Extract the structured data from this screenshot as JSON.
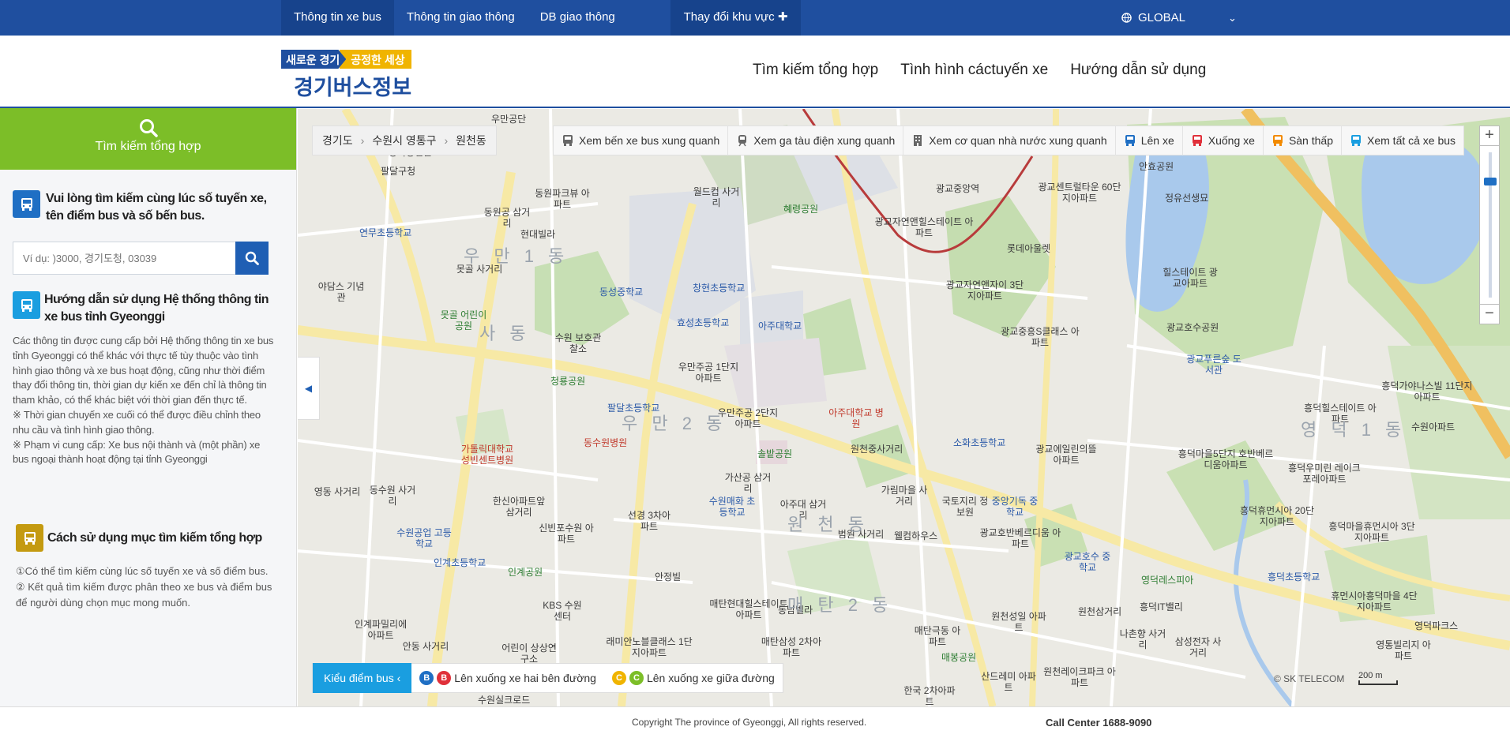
{
  "topbar": {
    "nav": [
      "Thông tin xe bus",
      "Thông tin giao thông",
      "DB giao thông"
    ],
    "region_button": "Thay đổi khu vực ✚",
    "language": "GLOBAL"
  },
  "header": {
    "logo_line1a": "새로운 경기",
    "logo_line1b": "공정한 세상",
    "logo_line2": "경기버스정보",
    "nav": [
      "Tìm kiếm tổng hợp",
      "Tình hình cáctuyến xe",
      "Hướng dẫn sử dụng"
    ]
  },
  "sidebar": {
    "title": "Tìm kiếm tổng hợp",
    "intro": "Vui lòng tìm kiếm cùng lúc số tuyến xe, tên điểm bus và số bến bus.",
    "search_placeholder": "Ví dụ: )3000, 경기도청, 03039",
    "guide_title": "Hướng dẫn sử dụng Hệ thống thông tin xe bus tỉnh Gyeonggi",
    "guide_text": [
      "Các thông tin được cung cấp bởi Hệ thống thông tin xe bus tỉnh Gyeonggi có thể khác với thực tế tùy thuộc vào tình hình giao thông và xe bus hoạt động, cũng như thời điểm thay đổi thông tin, thời gian dự kiến xe đến chỉ là thông tin tham khảo, có thể khác biệt với thời gian đến thực tế.",
      "※ Thời gian chuyến xe cuối có thể được điều chỉnh theo nhu cầu và tình hình giao thông.",
      "※ Phạm vi cung cấp: Xe bus nội thành và (một phần) xe bus ngoại thành hoạt động tại tỉnh Gyeonggi"
    ],
    "usage_title": "Cách sử dụng mục tìm kiếm tổng hợp",
    "usage_text": [
      "①Có thể tìm kiếm cùng lúc số tuyến xe và số điểm bus.",
      "② Kết quả tìm kiếm được phân theo xe bus và điểm bus để người dùng chọn mục mong muốn."
    ]
  },
  "map": {
    "breadcrumb": [
      "경기도",
      "수원시 영통구",
      "원천동"
    ],
    "toolbar": [
      {
        "icon": "bus-icon",
        "label": "Xem bến xe bus xung quanh",
        "color": "#555555"
      },
      {
        "icon": "train-icon",
        "label": "Xem ga tàu điện xung quanh",
        "color": "#555555"
      },
      {
        "icon": "building-icon",
        "label": "Xem cơ quan nhà nước xung quanh",
        "color": "#555555"
      },
      {
        "icon": "bus-icon",
        "label": "Lên xe",
        "color": "#1f6fc4"
      },
      {
        "icon": "bus-icon",
        "label": "Xuống xe",
        "color": "#e0303a"
      },
      {
        "icon": "bus-icon",
        "label": "Sàn thấp",
        "color": "#f28a00"
      },
      {
        "icon": "bus-icon",
        "label": "Xem tất cả xe bus",
        "color": "#1a9ee0"
      }
    ],
    "legend_title": "Kiểu điểm bus",
    "legend_items": [
      "Lên xuống xe hai bên đường",
      "Lên xuống xe giữa đường"
    ],
    "legend_badges": {
      "b_blue": "B",
      "b_red": "B",
      "c_yellow": "C",
      "c_green": "C"
    },
    "provider": "© SK TELECOM",
    "scale": "200 m",
    "labels": [
      "우만공단",
      "동북공심론",
      "동원파크뷰 아파트",
      "현대빌라",
      "동성중학교",
      "월드컵 사거리",
      "혜령공원",
      "광교중앙역",
      "광교자연앤힐스테이트 아파트",
      "롯데아울렛",
      "광교센트럴타운 60단지아파트",
      "안효공원",
      "창현초등학교",
      "효성초등학교",
      "아주대학교",
      "수원 보호관찰소",
      "우만주공 1단지아파트",
      "팔달초등학교",
      "우만주공 2단지아파트",
      "아주대학교 병원",
      "원천중사거리",
      "소화초등학교",
      "광교에일린의뜰 아파트",
      "광교중흥S클래스 아파트",
      "광교자연앤자이 3단지아파트",
      "가톨릭대학교 성빈센트병원",
      "동수원병원",
      "청룡공원",
      "솔밭공원",
      "수원매화 초등학교",
      "인계초등학교",
      "인계공원",
      "KBS 수원센터",
      "안정빌",
      "매탄현대힐스테이트 아파트",
      "동남빌라",
      "래미안노블클래스 1단지아파트",
      "매탄삼성 2차아파트",
      "광교호반베르디움 아파트",
      "광교호수 중학교",
      "영덕레스피아",
      "흥덕IT밸리",
      "원천삼거리",
      "나촌향 사거리",
      "삼성전자 사거리",
      "원천레이크파크 아파트",
      "광교푸른숲 도서관",
      "흥덕마을5단지 호반베르디움아파트",
      "흥덕휴먼시아 20단지아파트",
      "흥덕우미린 레이크포레아파트",
      "흥덕마을휴먼시아 3단지아파트",
      "흥덕초등학교",
      "휴먼시아흥덕마을 4단지아파트",
      "영덕파크스",
      "영통빌리지 아파트",
      "한국 2차아파트",
      "정유선생묘",
      "힐스테이트 광교아파트",
      "광교호수공원",
      "흥덕힐스테이트 아파트",
      "흥덕가야나스빌 11단지아파트",
      "수원아파트",
      "원천성일 아파트",
      "매탄극동 아파트",
      "매봉공원",
      "산드레미 아파트",
      "국토지리 정보원",
      "중앙기독 중학교",
      "가림마을 사거리",
      "웰컴하우스",
      "범원 사거리",
      "아주대 삼거리",
      "가산공 삼거리",
      "선경 3차아파트",
      "신빈포수원 아파트",
      "한신아파트앞 삼거리",
      "수원공업 고등학교",
      "동수원 사거리",
      "영동 사거리",
      "인계파밀리에 아파트",
      "어린이 상상연구소",
      "수원실크로드",
      "안동 사거리",
      "팔달구청",
      "야담스 기념관",
      "연무초등학교",
      "못골 사거리",
      "못골 어린이공원",
      "동원공 삼거리"
    ],
    "district_labels": [
      "우 만 1 동",
      "우 만 2 동",
      "원 천 동",
      "매 탄 2 동",
      "영 덕 1 동",
      "사 동"
    ]
  },
  "footer": {
    "copyright": "Copyright The province of Gyeonggi, All rights reserved.",
    "call_center": "Call Center 1688-9090"
  },
  "colors": {
    "primary": "#1f4f9f",
    "sidebar_accent": "#7cbe28",
    "search_button": "#1f5fb4",
    "legend_accent": "#1a9ee0"
  }
}
